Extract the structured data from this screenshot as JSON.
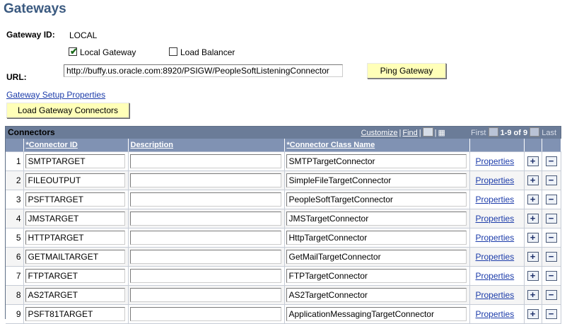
{
  "page": {
    "title": "Gateways",
    "gateway_id_label": "Gateway ID:",
    "gateway_id_value": "LOCAL",
    "local_gateway_label": "Local Gateway",
    "local_gateway_checked": true,
    "load_balancer_label": "Load Balancer",
    "load_balancer_checked": false,
    "url_label": "URL:",
    "url_value": "http://buffy.us.oracle.com:8920/PSIGW/PeopleSoftListeningConnector",
    "ping_button": "Ping Gateway",
    "setup_link": "Gateway Setup Properties",
    "load_connectors_button": "Load Gateway Connectors"
  },
  "grid": {
    "title": "Connectors",
    "customize": "Customize",
    "find": "Find",
    "first": "First",
    "range": "1-9 of 9",
    "last": "Last",
    "columns": {
      "connector_id": "*Connector ID",
      "description": "Description",
      "class_name": "*Connector Class Name"
    },
    "properties_label": "Properties",
    "add_symbol": "+",
    "remove_symbol": "−",
    "rows": [
      {
        "num": "1",
        "id": "SMTPTARGET",
        "desc": "",
        "class": "SMTPTargetConnector"
      },
      {
        "num": "2",
        "id": "FILEOUTPUT",
        "desc": "",
        "class": "SimpleFileTargetConnector"
      },
      {
        "num": "3",
        "id": "PSFTTARGET",
        "desc": "",
        "class": "PeopleSoftTargetConnector"
      },
      {
        "num": "4",
        "id": "JMSTARGET",
        "desc": "",
        "class": "JMSTargetConnector"
      },
      {
        "num": "5",
        "id": "HTTPTARGET",
        "desc": "",
        "class": "HttpTargetConnector"
      },
      {
        "num": "6",
        "id": "GETMAILTARGET",
        "desc": "",
        "class": "GetMailTargetConnector"
      },
      {
        "num": "7",
        "id": "FTPTARGET",
        "desc": "",
        "class": "FTPTargetConnector"
      },
      {
        "num": "8",
        "id": "AS2TARGET",
        "desc": "",
        "class": "AS2TargetConnector"
      },
      {
        "num": "9",
        "id": "PSFT81TARGET",
        "desc": "",
        "class": "ApplicationMessagingTargetConnector"
      }
    ]
  }
}
